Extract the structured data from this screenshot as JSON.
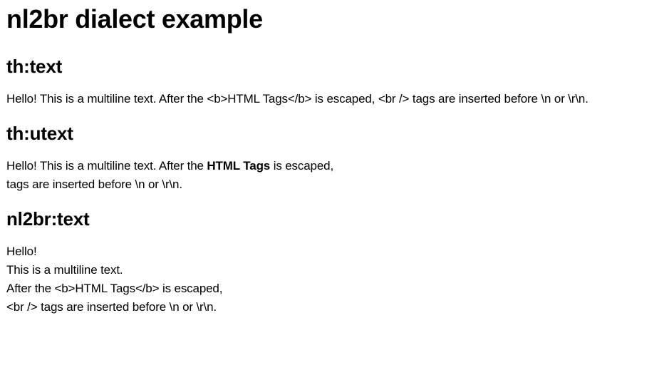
{
  "page": {
    "title": "nl2br dialect example"
  },
  "sections": {
    "text": {
      "heading": "th:text",
      "paragraph": "Hello! This is a multiline text. After the <b>HTML Tags</b> is escaped, <br /> tags are inserted before \\n or \\r\\n."
    },
    "utext": {
      "heading": "th:utext",
      "line1_before": "Hello! This is a multiline text. After the ",
      "line1_bold": "HTML Tags",
      "line1_after": " is escaped,",
      "line2": "tags are inserted before \\n or \\r\\n."
    },
    "nl2br": {
      "heading": "nl2br:text",
      "lines": [
        "Hello!",
        "This is a multiline text.",
        "After the <b>HTML Tags</b> is escaped,",
        "<br /> tags are inserted before \\n or \\r\\n."
      ]
    }
  }
}
